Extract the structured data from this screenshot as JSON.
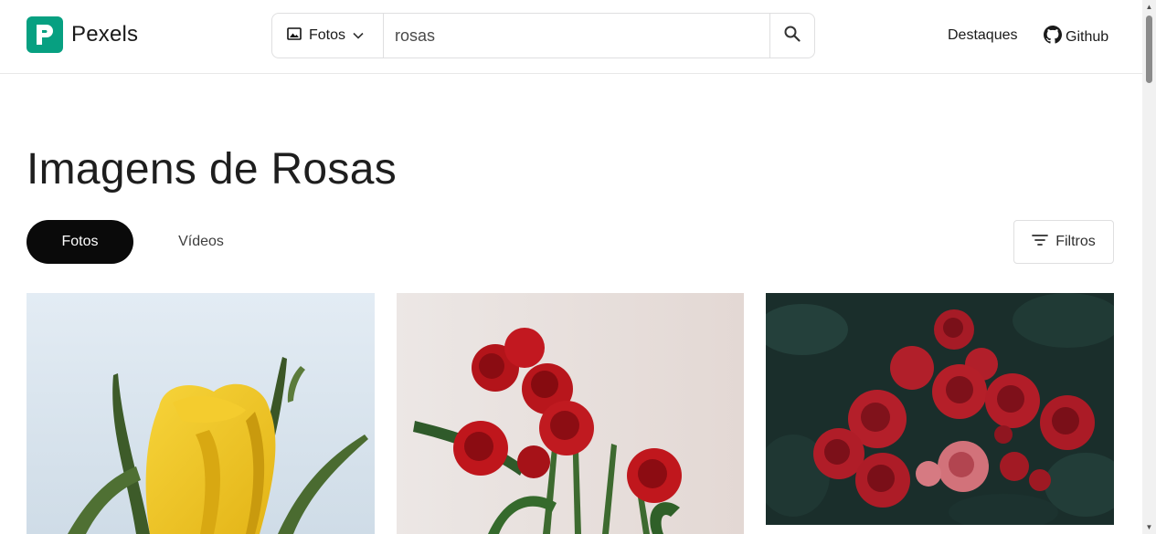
{
  "header": {
    "brand": "Pexels",
    "search": {
      "type_label": "Fotos",
      "query": "rosas"
    },
    "nav": {
      "destaques": "Destaques",
      "github": "Github"
    }
  },
  "main": {
    "title": "Imagens de Rosas",
    "tabs": [
      {
        "label": "Fotos",
        "active": true
      },
      {
        "label": "Vídeos",
        "active": false
      }
    ],
    "filters_label": "Filtros"
  },
  "colors": {
    "brand": "#07a081",
    "active_tab": "#0a0a0a"
  },
  "icons": {
    "logo": "pexels-logo-icon",
    "search_type": "image-icon",
    "dropdown": "chevron-down-icon",
    "search": "search-icon",
    "github": "github-icon",
    "filters": "filter-lines-icon"
  }
}
